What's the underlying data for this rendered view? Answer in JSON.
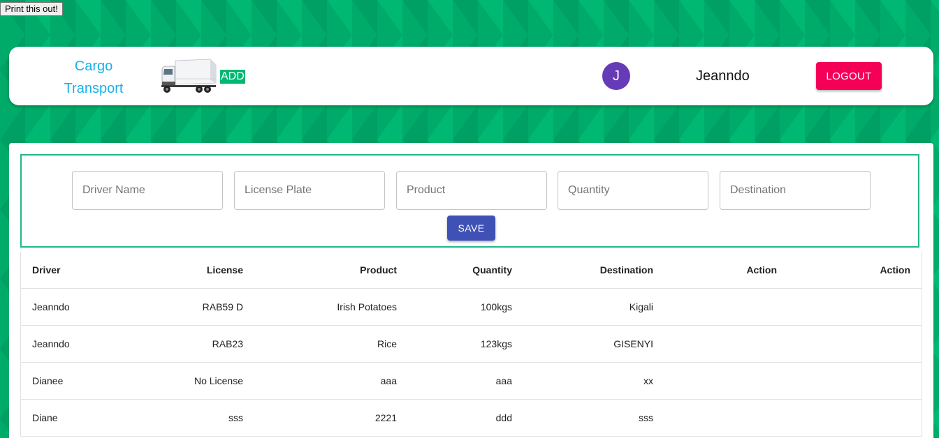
{
  "print_button": {
    "label": "Print this out!"
  },
  "header": {
    "brand": {
      "line1": "Cargo",
      "line2": "Transport"
    },
    "add_label": "ADD",
    "avatar_initial": "J",
    "username": "Jeanndo",
    "logout_label": "LOGOUT"
  },
  "form": {
    "fields": [
      {
        "placeholder": "Driver Name",
        "value": ""
      },
      {
        "placeholder": "License Plate",
        "value": ""
      },
      {
        "placeholder": "Product",
        "value": ""
      },
      {
        "placeholder": "Quantity",
        "value": ""
      },
      {
        "placeholder": "Destination",
        "value": ""
      }
    ],
    "save_label": "SAVE"
  },
  "table": {
    "headers": [
      "Driver",
      "License",
      "Product",
      "Quantity",
      "Destination",
      "Action",
      "Action"
    ],
    "rows": [
      {
        "driver": "Jeanndo",
        "license": "RAB59 D",
        "product": "Irish Potatoes",
        "quantity": "100kgs",
        "destination": "Kigali",
        "action1": "",
        "action2": ""
      },
      {
        "driver": "Jeanndo",
        "license": "RAB23",
        "product": "Rice",
        "quantity": "123kgs",
        "destination": "GISENYI",
        "action1": "",
        "action2": ""
      },
      {
        "driver": "Dianee",
        "license": "No License",
        "product": "aaa",
        "quantity": "aaa",
        "destination": "xx",
        "action1": "",
        "action2": ""
      },
      {
        "driver": "Diane",
        "license": "sss",
        "product": "2221",
        "quantity": "ddd",
        "destination": "sss",
        "action1": "",
        "action2": ""
      }
    ]
  },
  "colors": {
    "background": "#00b872",
    "brand": "#1ab0e8",
    "add_tag": "#00b872",
    "avatar": "#673ab7",
    "logout": "#f50057",
    "save": "#3f51b5",
    "form_border": "#1fb98a"
  },
  "icons": {
    "truck": "truck-image",
    "avatar": "avatar-icon"
  }
}
